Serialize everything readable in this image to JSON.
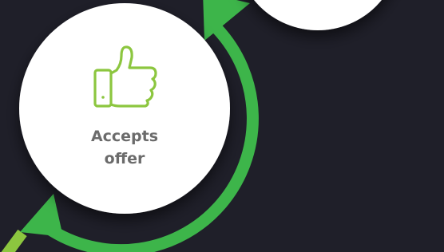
{
  "diagram": {
    "step": {
      "label": "Accepts\noffer",
      "icon": "thumbs-up-icon",
      "icon_color": "#8cc63f"
    },
    "colors": {
      "background": "#1f1f29",
      "node_fill": "#ffffff",
      "flow_arrow": "#3db54a",
      "incoming_arrow": "#8cc63f",
      "label_text": "#6b6b6b"
    }
  }
}
